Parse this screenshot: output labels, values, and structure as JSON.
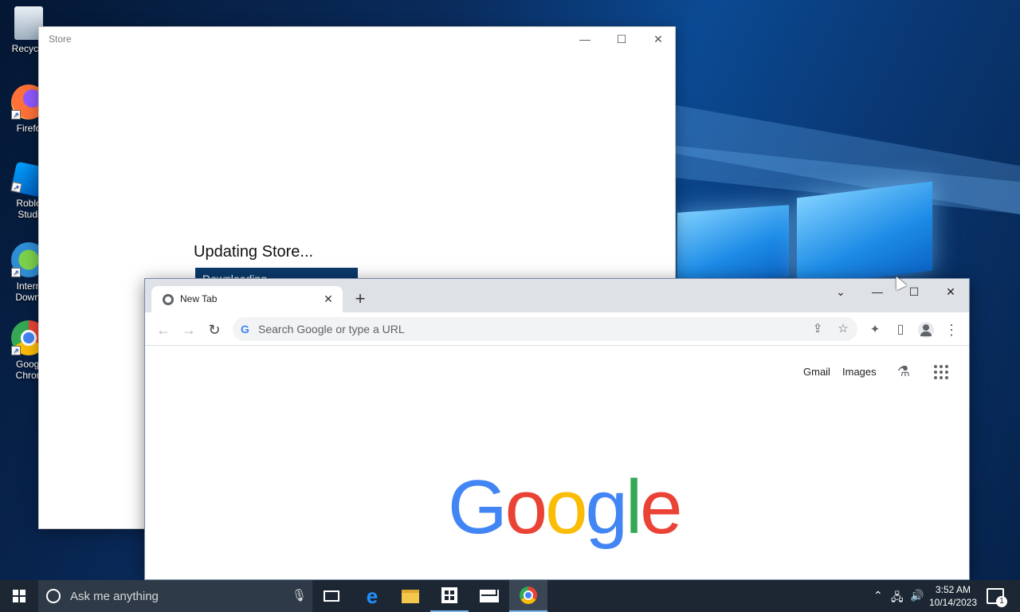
{
  "desktop": {
    "icons": [
      {
        "label": "Recycle",
        "icon": "recycle-bin-icon"
      },
      {
        "label": "Firefo",
        "icon": "firefox-icon"
      },
      {
        "label": "Roblo Studi",
        "icon": "roblox-studio-icon"
      },
      {
        "label": "Intern Downl",
        "icon": "internet-download-manager-icon"
      },
      {
        "label": "Googl Chron",
        "icon": "google-chrome-icon"
      }
    ]
  },
  "store": {
    "title": "Store",
    "status": "Updating Store...",
    "progress_label": "Downloading",
    "controls": {
      "minimize": "—",
      "maximize": "☐",
      "close": "✕"
    }
  },
  "chrome": {
    "tab": {
      "title": "New Tab",
      "close": "✕"
    },
    "new_tab": "+",
    "controls": {
      "tab_search": "⌄",
      "minimize": "—",
      "maximize": "☐",
      "close": "✕"
    },
    "nav": {
      "back": "←",
      "forward": "→",
      "reload": "↻"
    },
    "omnibox": {
      "placeholder": "Search Google or type a URL",
      "g": "G"
    },
    "toolbar_icons": {
      "share": "⇪",
      "star": "☆",
      "extensions": "✦",
      "side_panel": "▯",
      "profile": "●",
      "menu": "⋮"
    },
    "ntp": {
      "links": [
        "Gmail",
        "Images"
      ],
      "labs": "⚗",
      "logo_letters": [
        {
          "ch": "G",
          "color": "#4285f4"
        },
        {
          "ch": "o",
          "color": "#ea4335"
        },
        {
          "ch": "o",
          "color": "#fbbc05"
        },
        {
          "ch": "g",
          "color": "#4285f4"
        },
        {
          "ch": "l",
          "color": "#34a853"
        },
        {
          "ch": "e",
          "color": "#ea4335"
        }
      ]
    }
  },
  "taskbar": {
    "search_placeholder": "Ask me anything",
    "mic": "🎙",
    "apps": [
      "task-view",
      "edge",
      "file-explorer",
      "store",
      "mail",
      "chrome"
    ],
    "tray": {
      "chevron": "⌃",
      "network": "🖧",
      "volume": "🔊"
    },
    "time": "3:52 AM",
    "date": "10/14/2023",
    "notifications": "1"
  }
}
